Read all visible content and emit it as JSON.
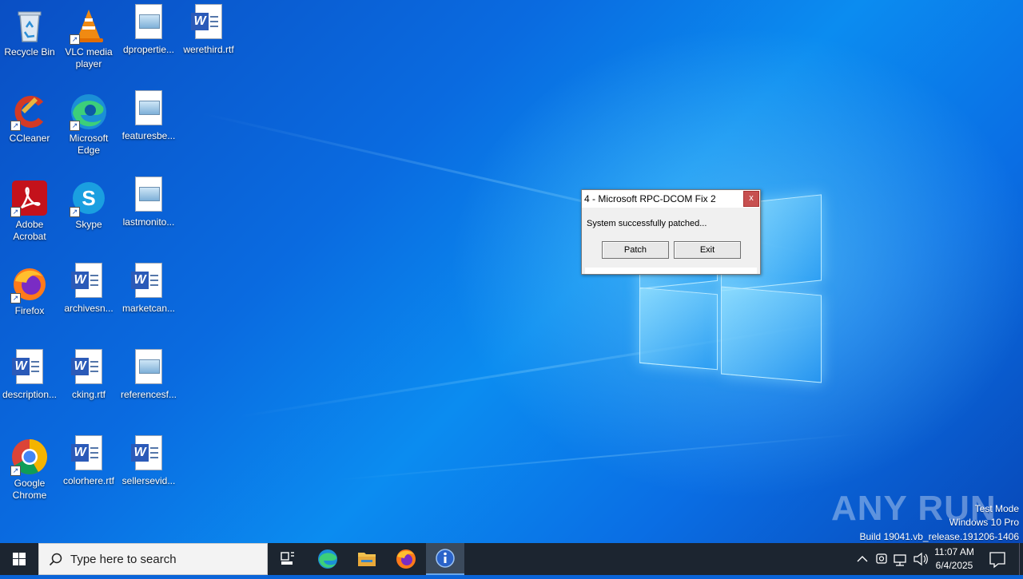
{
  "desktop_icons": [
    {
      "label": "Recycle Bin"
    },
    {
      "label": "VLC media player"
    },
    {
      "label": "dpropertie..."
    },
    {
      "label": "werethird.rtf"
    },
    {
      "label": "CCleaner"
    },
    {
      "label": "Microsoft Edge"
    },
    {
      "label": "featuresbe..."
    },
    {
      "label": "Adobe Acrobat"
    },
    {
      "label": "Skype"
    },
    {
      "label": "lastmonito..."
    },
    {
      "label": "Firefox"
    },
    {
      "label": "archivesn..."
    },
    {
      "label": "marketcan..."
    },
    {
      "label": "description..."
    },
    {
      "label": "cking.rtf"
    },
    {
      "label": "referencesf..."
    },
    {
      "label": "Google Chrome"
    },
    {
      "label": "colorhere.rtf"
    },
    {
      "label": "sellersevid..."
    }
  ],
  "dialog": {
    "title": "4 - Microsoft RPC-DCOM Fix 2",
    "close_label": "x",
    "message": "System successfully patched...",
    "patch_label": "Patch",
    "exit_label": "Exit"
  },
  "taskbar": {
    "search_placeholder": "Type here to search",
    "time": "11:07 AM",
    "date": "6/4/2025"
  },
  "watermark": {
    "brand": "ANY RUN",
    "line1": "Test Mode",
    "line2": "Windows 10 Pro",
    "line3": "Build 19041.vb_release.191206-1406"
  },
  "colors": {
    "desktop": "#0a6be0",
    "taskbar": "#1c2530",
    "dialog_close": "#c75050"
  }
}
